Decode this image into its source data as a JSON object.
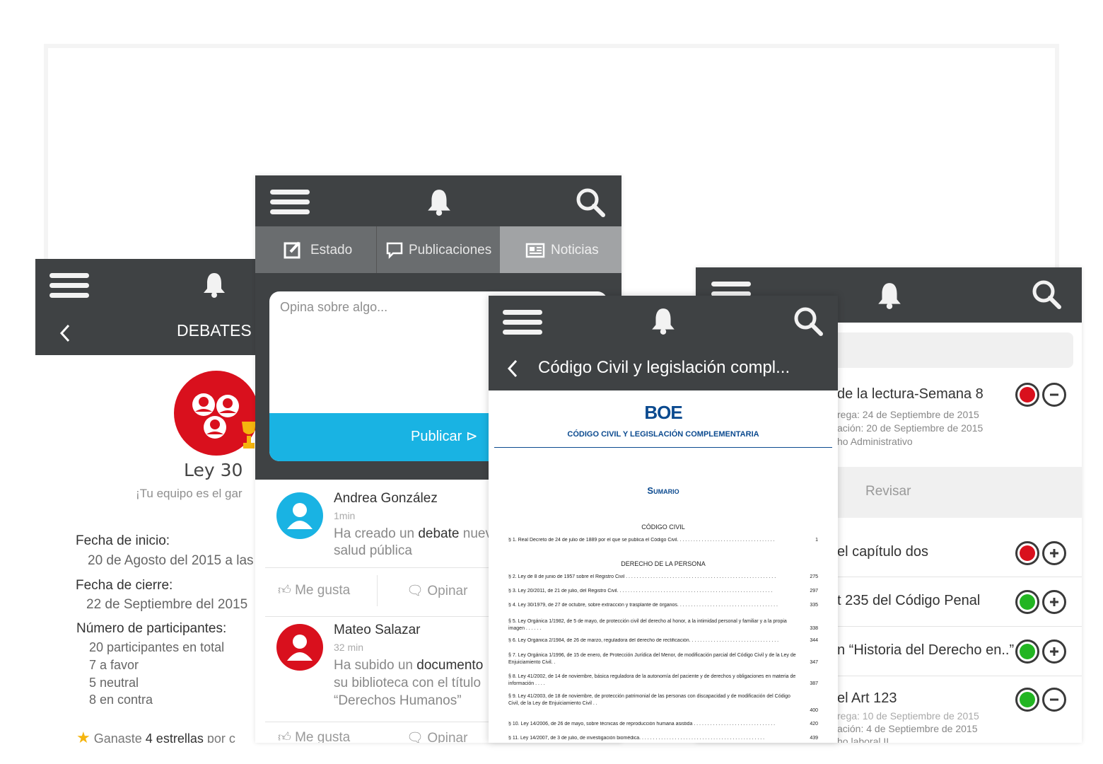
{
  "brand": {
    "dark_bar": "#3f4244",
    "accent_blue": "#19b3e3",
    "accent_red": "#d9101d",
    "green": "#22b522",
    "boe_blue": "#0b4a8f"
  },
  "debates": {
    "header_title": "DEBATES",
    "debate_title": "Ley 30",
    "subtitle": "¡Tu equipo es el gar",
    "start_label": "Fecha de inicio:",
    "start_value": "20 de Agosto del 2015 a las",
    "end_label": "Fecha de cierre:",
    "end_value": "22 de Septiembre del 2015",
    "participants_label": "Número de participantes:",
    "participants_total": "20 participantes en total",
    "favor": "7 a favor",
    "neutral": "5 neutral",
    "against": "8 en contra",
    "stars_prefix": "Ganaste ",
    "stars_bold": "4 estrellas",
    "stars_suffix": " por c"
  },
  "feed": {
    "tabs": [
      {
        "label": "Estado",
        "icon": "edit-icon"
      },
      {
        "label": "Publicaciones",
        "icon": "comment-icon"
      },
      {
        "label": "Noticias",
        "icon": "newspaper-icon"
      }
    ],
    "compose_placeholder": "Opina sobre algo...",
    "publish_label": "Publicar ⊳",
    "posts": [
      {
        "author": "Andrea González",
        "time": "1min",
        "text_a": "Ha creado un ",
        "text_bold": "debate",
        "text_b": " nuev",
        "text_line2": "salud pública",
        "avatar_color": "#19b3e3"
      },
      {
        "author": "Mateo Salazar",
        "time": "32 min",
        "text_a": "Ha subido un ",
        "text_bold": "documento",
        "text_b": "",
        "text_line2": "su biblioteca con el título",
        "text_line3": "“Derechos Humanos”",
        "avatar_color": "#d9101d"
      }
    ],
    "like_label": "Me gusta",
    "comment_label": "Opinar"
  },
  "document": {
    "title": "Código Civil y legislación compl...",
    "boe_logo": "BOE",
    "heading": "CÓDIGO CIVIL Y LEGISLACIÓN COMPLEMENTARIA",
    "sumario": "Sumario",
    "section1": "CÓDIGO CIVIL",
    "section2": "DERECHO DE LA PERSONA",
    "entries": [
      {
        "text": "§ 1. Real Decreto de 24 de julio de 1889 por el que se publica el Código Civil. . . . . . . . . . . . . . . . . . . . . . . . . . . . . . . . . . . .",
        "num": "1"
      },
      {
        "text": "§ 2. Ley de 8 de junio de 1957 sobre el Registro Civil . . . . . . . . . . . . . . . . . . . . . . . . . . . . . . . . . . . . . . . . . . . . . . . . . . . . . . .",
        "num": "275"
      },
      {
        "text": "§ 3. Ley 20/2011, de 21 de julio, del Registro Civil. . . . . . . . . . . . . . . . . . . . . . . . . . . . . . . . . . . . . . . . . . . . . . . . . . . . . . . . .",
        "num": "297"
      },
      {
        "text": "§ 4. Ley 30/1979, de 27 de octubre, sobre extracción y trasplante de órganos. . . . . . . . . . . . . . . . . . . . . . . . . . . . . . . . . . . . .",
        "num": "335"
      },
      {
        "text": "§ 5. Ley Orgánica 1/1982, de 5 de mayo, de protección civil del derecho al honor, a la intimidad personal y familiar y a la propia imagen . . . . . .",
        "num": "338"
      },
      {
        "text": "§ 6. Ley Orgánica 2/1984, de 26 de marzo, reguladora del derecho de rectificación. . . . . . . . . . . . . . . . . . . . . . . . . . . . . . . . .",
        "num": "344"
      },
      {
        "text": "§ 7. Ley Orgánica 1/1996, de 15 de enero, de Protección Jurídica del Menor, de modificación parcial del Código Civil y de la Ley de Enjuiciamiento Civil. .",
        "num": "347"
      },
      {
        "text": "§ 8. Ley 41/2002, de 14 de noviembre, básica reguladora de la autonomía del paciente y de derechos y obligaciones en materia de información . . . .",
        "num": "387"
      },
      {
        "text": "§ 9. Ley 41/2003, de 18 de noviembre, de protección patrimonial de las personas con discapacidad y de modificación del Código Civil, de la Ley de Enjuiciamiento Civil . .",
        "num": "400"
      },
      {
        "text": "§ 10. Ley 14/2006, de 26 de mayo, sobre técnicas de reproducción humana asistida . . . . . . . . . . . . . . . . . . . . . . . . . . . . . .",
        "num": "420"
      },
      {
        "text": "§ 11. Ley 14/2007, de 3 de julio, de investigación biomédica. . . . . . . . . . . . . . . . . . . . . . . . . . . . . . . . . . . . . . . . . . . . . .",
        "num": "439"
      }
    ]
  },
  "tasks": {
    "item1_title": "de la lectura-Semana 8",
    "item1_line1": "rega: 24 de Septiembre de 2015",
    "item1_line2": "ación: 20 de Septiembre de 2015",
    "item1_line3": "ho Administrativo",
    "review_label": "Revisar",
    "item2_title": "el capítulo dos",
    "item3_title": "t 235 del Código Penal",
    "item4_title": "n “Historia del Derecho en..”",
    "item5_title": "el Art 123",
    "item5_line1": "rega: 10 de Septiembre de 2015",
    "item5_line2": "ación: 4 de Septiembre de 2015",
    "item5_line3": "ho laboral II"
  }
}
